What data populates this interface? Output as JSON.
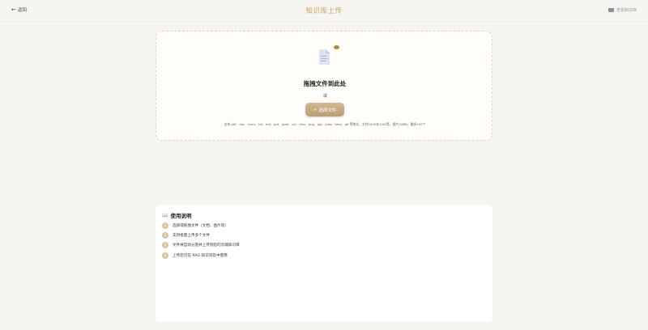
{
  "header": {
    "back_label": "返回",
    "title": "知识库上传",
    "right_link_label": "查看知识库"
  },
  "upload": {
    "drop_title": "拖拽文件到此处",
    "small_marker": "或",
    "select_button_label": "选择文件",
    "support_text": "支持 pdf、doc、docx、txt、md、ppt、pptx、xls、xlsx、png、jpg、jpeg、bmp、gif 等格式，文件1000本/10G等，图片20MB，最多100个"
  },
  "guide": {
    "title": "使用说明",
    "steps": [
      {
        "num": "1",
        "text": "选择或拖拽文件（文档、图片等）"
      },
      {
        "num": "2",
        "text": "支持批量上传多个文件"
      },
      {
        "num": "3",
        "text": "文件将自动分割并上传到您的云端知识库"
      },
      {
        "num": "4",
        "text": "上传后可在 RAG 知识问答中使用"
      }
    ]
  },
  "colors": {
    "accent": "#c7a36a",
    "button_top": "#cfb893",
    "button_bottom": "#b99f77",
    "step_badge": "#d8c4a3"
  }
}
